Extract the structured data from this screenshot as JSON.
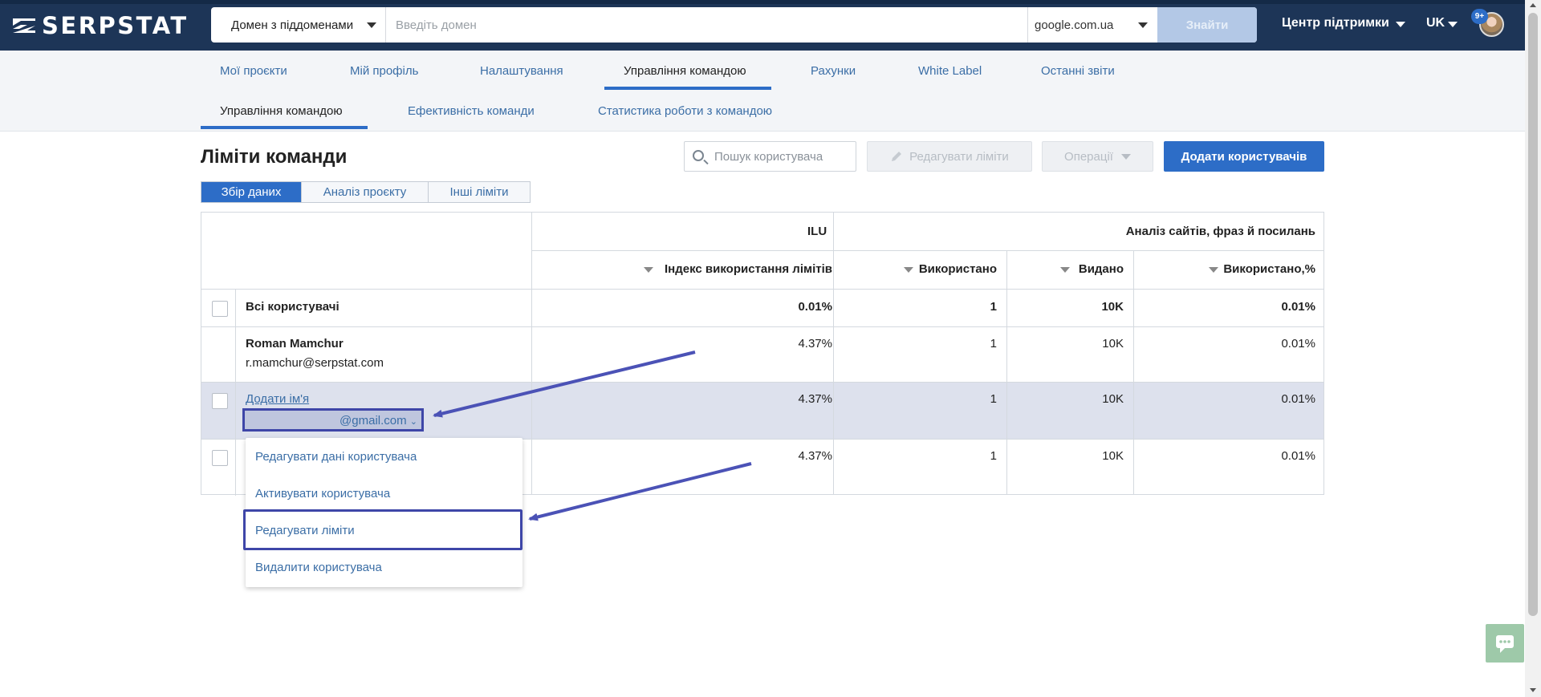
{
  "header": {
    "logo_text": "SERPSTAT",
    "search_type": "Домен з піддоменами",
    "domain_placeholder": "Введіть домен",
    "database": "google.com.ua",
    "find_button": "Знайти",
    "support": "Центр підтримки",
    "language": "UK",
    "notifications_badge": "9+"
  },
  "nav": {
    "tabs": [
      {
        "label": "Мої проєкти"
      },
      {
        "label": "Мій профіль"
      },
      {
        "label": "Налаштування"
      },
      {
        "label": "Управління командою"
      },
      {
        "label": "Рахунки"
      },
      {
        "label": "White Label"
      },
      {
        "label": "Останні звіти"
      }
    ],
    "subtabs": [
      {
        "label": "Управління командою"
      },
      {
        "label": "Ефективність команди"
      },
      {
        "label": "Статистика роботи з командою"
      }
    ]
  },
  "main": {
    "title": "Ліміти команди",
    "user_search_placeholder": "Пошук користувача",
    "edit_limits_button": "Редагувати ліміти",
    "operations_button": "Операції",
    "add_users_button": "Додати користувачів",
    "segments": [
      {
        "label": "Збір даних"
      },
      {
        "label": "Аналіз проєкту"
      },
      {
        "label": "Інші ліміти"
      }
    ]
  },
  "table": {
    "group_ilu": "ILU",
    "group_analysis": "Аналіз сайтів, фраз й посилань",
    "col_index": "Індекс використання лімітів",
    "col_used": "Використано",
    "col_issued": "Видано",
    "col_used_pct": "Використано,%",
    "rows": [
      {
        "name": "Всі користувачі",
        "email": "",
        "index": "0.01%",
        "used": "1",
        "issued": "10K",
        "pct": "0.01%"
      },
      {
        "name": "Roman Mamchur",
        "email": "r.mamchur@serpstat.com",
        "index": "4.37%",
        "used": "1",
        "issued": "10K",
        "pct": "0.01%"
      },
      {
        "name": "Додати ім'я",
        "email": "@gmail.com",
        "index": "4.37%",
        "used": "1",
        "issued": "10K",
        "pct": "0.01%"
      },
      {
        "name": "",
        "email": "",
        "index": "4.37%",
        "used": "1",
        "issued": "10K",
        "pct": "0.01%"
      }
    ]
  },
  "dropdown": {
    "items": [
      {
        "label": "Редагувати дані користувача"
      },
      {
        "label": "Активувати користувача"
      },
      {
        "label": "Редагувати ліміти"
      },
      {
        "label": "Видалити користувача"
      }
    ]
  },
  "colors": {
    "header_bg": "#1d3557",
    "accent": "#2d6dc7",
    "annotation": "#3e46a8",
    "link": "#3b6ea6"
  },
  "icons": {
    "logo": "serpstat-logo-icon",
    "search": "search-icon",
    "edit": "pencil-icon",
    "chat": "chat-icon"
  }
}
